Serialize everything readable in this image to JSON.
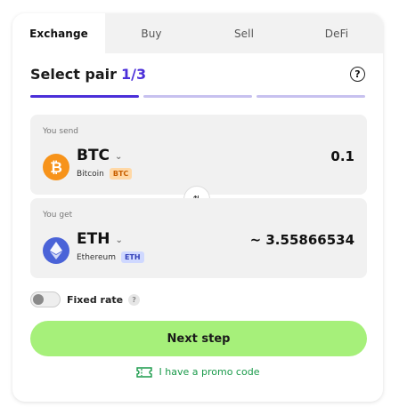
{
  "tabs": [
    {
      "label": "Exchange",
      "active": true
    },
    {
      "label": "Buy",
      "active": false
    },
    {
      "label": "Sell",
      "active": false
    },
    {
      "label": "DeFi",
      "active": false
    }
  ],
  "header": {
    "title": "Select pair",
    "step": "1/3",
    "help_icon": "question-circle-icon",
    "progress_steps": 3,
    "progress_active": 1
  },
  "send": {
    "label": "You send",
    "ticker": "BTC",
    "name": "Bitcoin",
    "badge": "BTC",
    "amount": "0.1",
    "icon": "bitcoin-icon"
  },
  "get": {
    "label": "You get",
    "ticker": "ETH",
    "name": "Ethereum",
    "badge": "ETH",
    "amount": "~ 3.55866534",
    "icon": "ethereum-icon"
  },
  "swap_icon": "swap-arrows-icon",
  "fixed_rate": {
    "label": "Fixed rate",
    "enabled": false,
    "hint": "?"
  },
  "next_button": "Next step",
  "promo": {
    "label": "I have a promo code",
    "icon": "ticket-icon"
  },
  "colors": {
    "accent": "#4b2fd9",
    "next_button": "#a6f07a",
    "promo": "#1a9a4a",
    "btc": "#f7931a",
    "eth": "#4a63d8"
  }
}
